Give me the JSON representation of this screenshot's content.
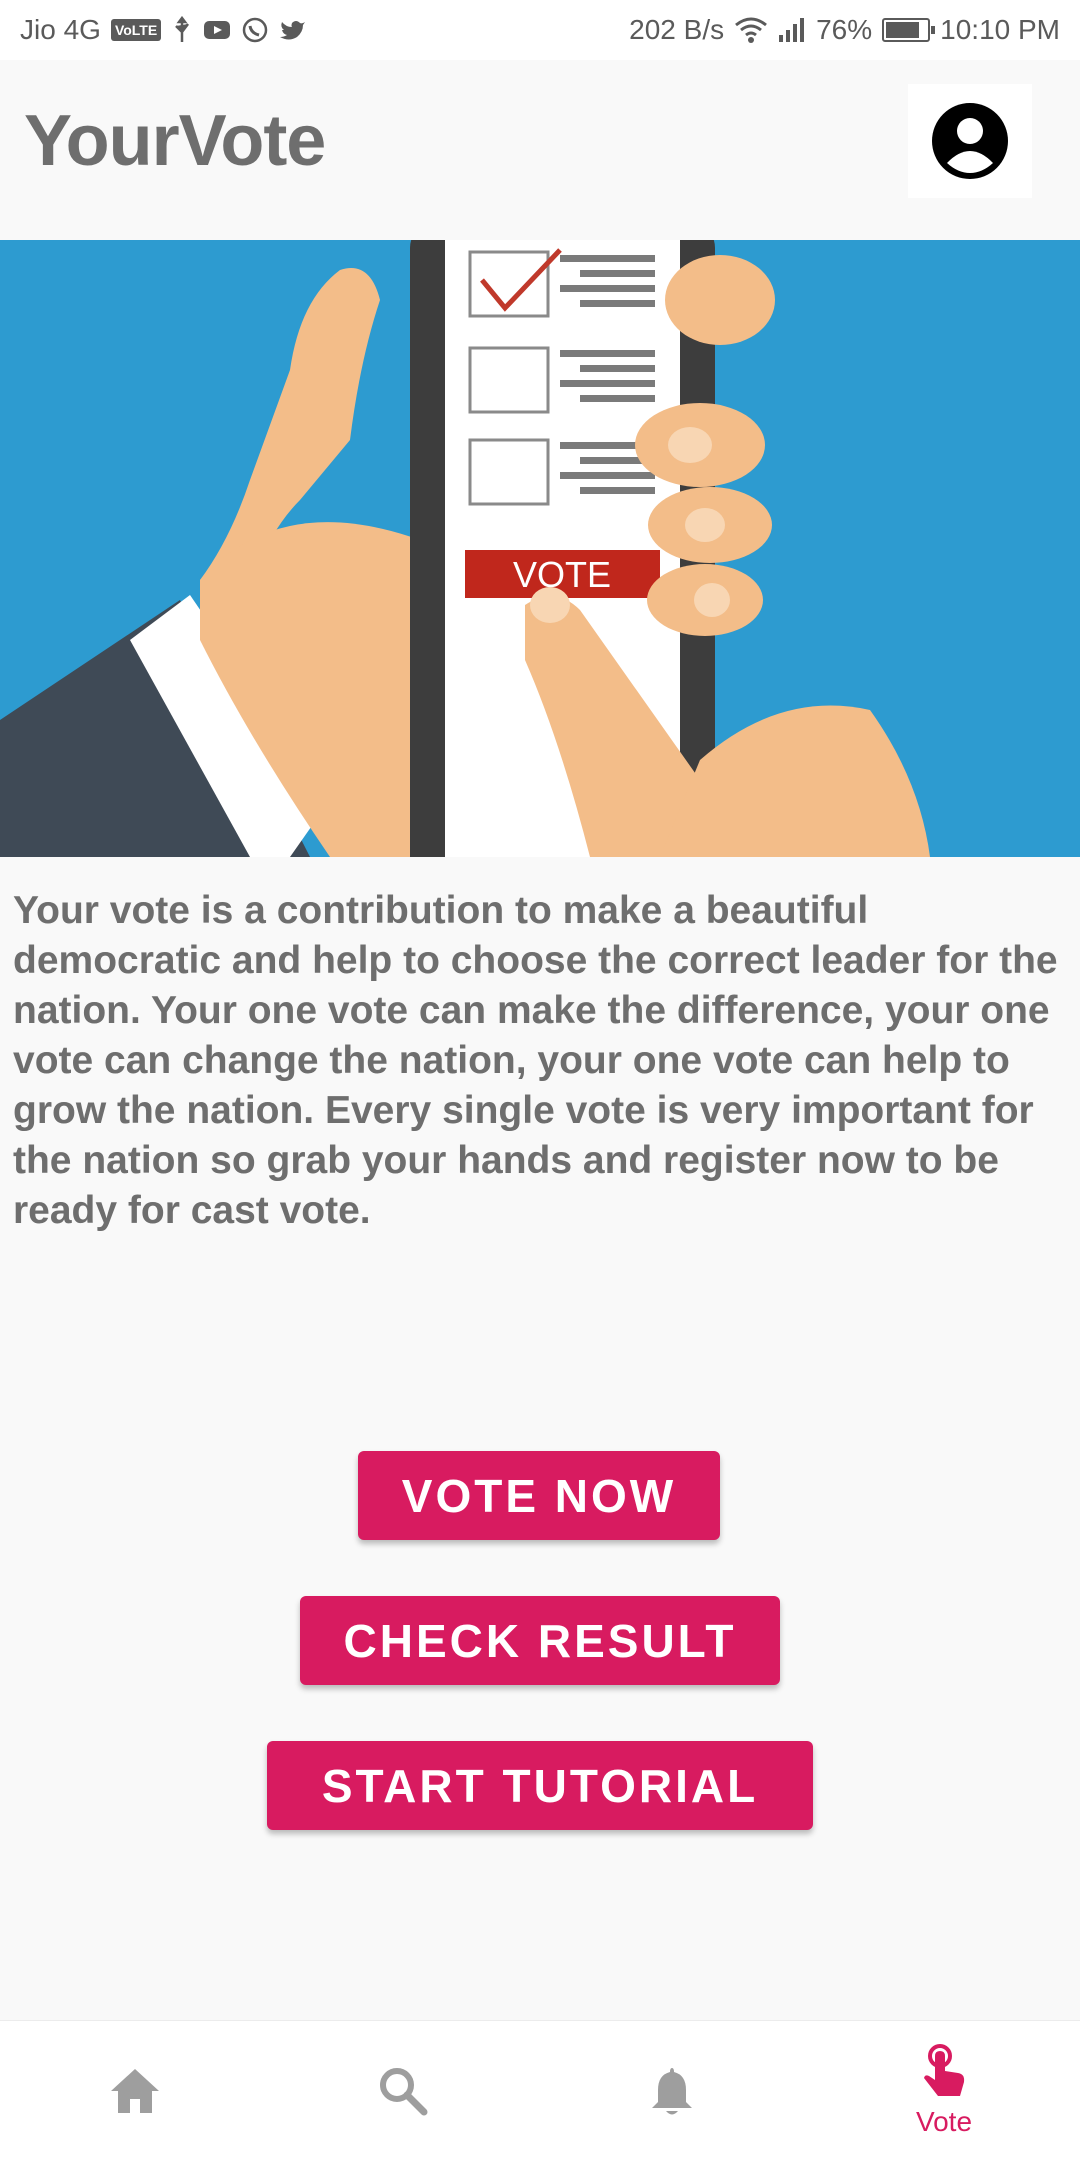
{
  "status_bar": {
    "carrier": "Jio 4G",
    "volte": "VoLTE",
    "net_speed": "202 B/s",
    "battery": "76%",
    "time": "10:10 PM"
  },
  "app": {
    "title": "YourVote"
  },
  "hero": {
    "phone_button_label": "VOTE"
  },
  "description": "Your vote is a contribution to make a beautiful democratic and help to choose the correct leader for the nation. Your one vote can make the difference, your one vote can change the nation, your one vote can help to grow the nation. Every single vote is very important for the nation so grab your hands and register now to be ready for cast vote.",
  "buttons": {
    "vote_now": "VOTE NOW",
    "check_result": "CHECK RESULT",
    "start_tutorial": "START TUTORIAL"
  },
  "bottom_nav": {
    "items": [
      {
        "icon": "home-icon",
        "label": ""
      },
      {
        "icon": "search-icon",
        "label": ""
      },
      {
        "icon": "bell-icon",
        "label": ""
      },
      {
        "icon": "touch-icon",
        "label": "Vote"
      }
    ],
    "active_color": "#d81b60",
    "inactive_color": "#9e9e9e"
  },
  "colors": {
    "accent": "#d81b60",
    "hero_background": "#2d9bd0",
    "title_text": "#6e6e6e"
  }
}
